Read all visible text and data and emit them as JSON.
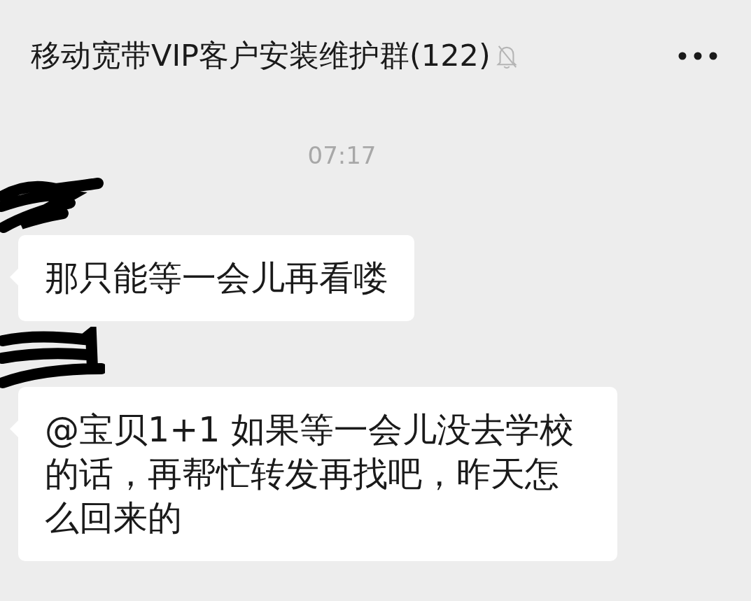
{
  "header": {
    "title": "移动宽带VIP客户安装维护群(122)",
    "muted": true
  },
  "messages": [
    {
      "kind": "time",
      "text": "07:17"
    },
    {
      "kind": "received",
      "sender_redacted": true,
      "text": "那只能等一会儿再看喽"
    },
    {
      "kind": "received",
      "sender_redacted": true,
      "text": "@宝贝1+1 如果等一会儿没去学校的话，再帮忙转发再找吧，昨天怎么回来的"
    }
  ]
}
